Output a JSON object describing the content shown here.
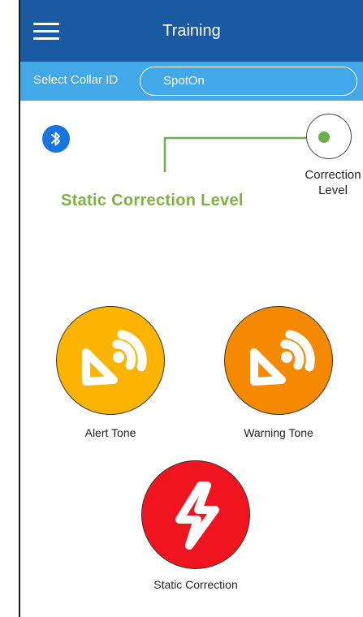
{
  "header": {
    "title": "Training",
    "menu_icon": "hamburger-menu-icon"
  },
  "collar": {
    "label": "Select Collar ID",
    "value": "SpotOn"
  },
  "bluetooth": {
    "icon": "bluetooth-icon",
    "color": "#1875e0"
  },
  "correction_level": {
    "label_line1": "Correction",
    "label_line2": "Level",
    "indicator_color": "#6ab04c"
  },
  "mode_title": "Static Correction Level",
  "buttons": {
    "alert_tone": {
      "label": "Alert Tone",
      "color": "#fcb400",
      "icon": "tone-icon"
    },
    "warning_tone": {
      "label": "Warning Tone",
      "color": "#f58a00",
      "icon": "tone-icon"
    },
    "static_correction": {
      "label": "Static Correction",
      "color": "#f0141e",
      "icon": "lightning-bolt-icon"
    }
  },
  "colors": {
    "navbar": "#1a5aa3",
    "collar_bar": "#42a8e8",
    "accent_green": "#7cb342"
  }
}
